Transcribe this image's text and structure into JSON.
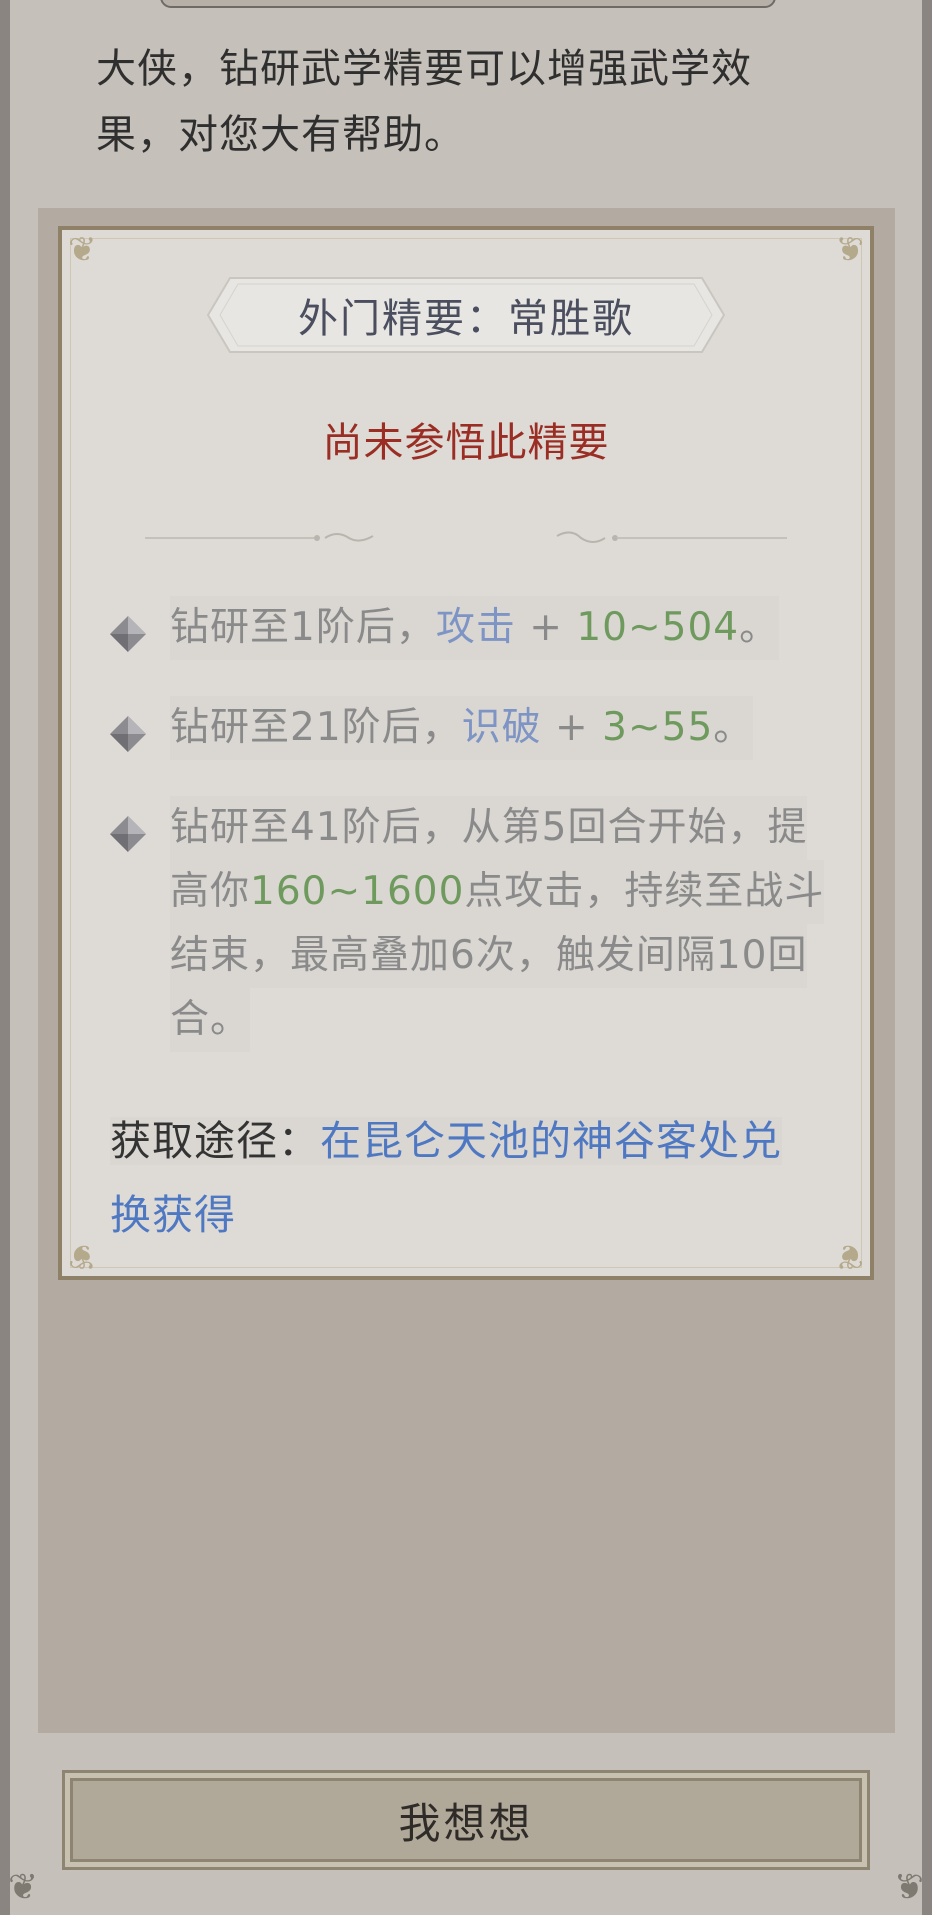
{
  "dialog": {
    "intro": "大侠，钻研武学精要可以增强武学效果，对您大有帮助。"
  },
  "card": {
    "title": "外门精要：常胜歌",
    "status": "尚未参悟此精要",
    "effects": [
      {
        "prefix": "钻研至1阶后，",
        "stat": "攻击",
        "plus": " + ",
        "value": "10~504",
        "suffix": "。"
      },
      {
        "prefix": "钻研至21阶后，",
        "stat": "识破",
        "plus": " + ",
        "value": "3~55",
        "suffix": "。"
      },
      {
        "line1": "钻研至41阶后，从第5回合开始，提",
        "line2_pre": "高你",
        "line2_value": "160~1600",
        "line2_post": "点攻击，持续至战斗",
        "line3": "结束，最高叠加6次，触发间隔10回",
        "line4": "合。"
      }
    ],
    "acquire_label": "获取途径：",
    "acquire_link_line1": "在昆仑天池的神谷客处兑",
    "acquire_link_line2": "换获得"
  },
  "button": {
    "label": "我想想"
  },
  "colors": {
    "status": "#9a2e24",
    "stat": "#7d94c4",
    "value": "#6f9a5e",
    "link": "#4f78c2"
  }
}
